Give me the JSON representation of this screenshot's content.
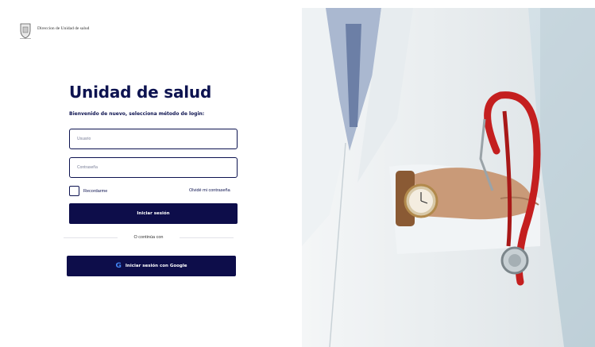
{
  "header": {
    "org_name": "Direccion de Unidad de salud"
  },
  "login": {
    "title": "Unidad de salud",
    "subtitle": "Bienvenido de nuevo, selecciona método de login:",
    "username_placeholder": "Usuario",
    "password_placeholder": "Contraseña",
    "remember_label": "Recordarme",
    "forgot_label": "Olvidé mi contraseña",
    "login_button": "Iniciar sesión",
    "divider_text": "O continúa con",
    "google_button": "Iniciar sesión con Google",
    "google_icon": "google-icon"
  },
  "colors": {
    "primary": "#0d1350",
    "button": "#0d0d4a",
    "background": "#ffffff"
  }
}
